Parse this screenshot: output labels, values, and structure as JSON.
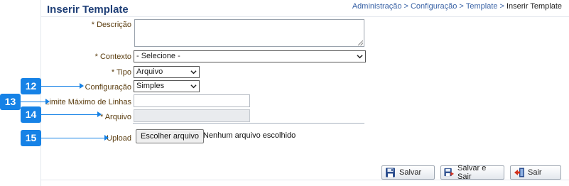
{
  "header": {
    "title": "Inserir Template",
    "breadcrumb": [
      "Administração",
      "Configuração",
      "Template"
    ],
    "breadcrumb_separator": ">",
    "breadcrumb_current": "Inserir Template"
  },
  "form": {
    "required_mark": "*",
    "descricao": {
      "label": "Descrição",
      "value": ""
    },
    "contexto": {
      "label": "Contexto",
      "selected": "- Selecione -"
    },
    "tipo": {
      "label": "Tipo",
      "selected": "Arquivo"
    },
    "configuracao": {
      "label": "Configuração",
      "selected": "Simples"
    },
    "limite": {
      "label": "Limite Máximo de Linhas",
      "value": ""
    },
    "arquivo": {
      "label": "Arquivo",
      "value": ""
    },
    "upload": {
      "label": "Upload",
      "button_label": "Escolher arquivo",
      "status": "Nenhum arquivo escolhido"
    }
  },
  "callouts": [
    "12",
    "13",
    "14",
    "15"
  ],
  "actions": {
    "salvar": "Salvar",
    "salvar_sair": "Salvar e Sair",
    "sair": "Sair"
  },
  "colors": {
    "accent": "#1682e6",
    "title": "#1f3f77",
    "label": "#5b3d0f",
    "link": "#3a63a6"
  }
}
